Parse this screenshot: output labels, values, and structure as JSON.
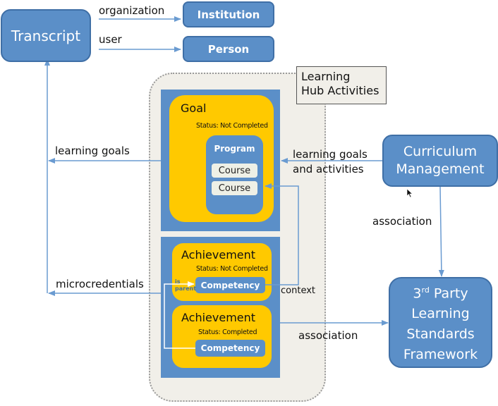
{
  "nodes": {
    "transcript": "Transcript",
    "institution": "Institution",
    "person": "Person",
    "curriculum_line1": "Curriculum",
    "curriculum_line2": "Management",
    "framework_line1_prefix": "3",
    "framework_line1_sup": "rd",
    "framework_line1_suffix": " Party",
    "framework_line2": "Learning",
    "framework_line3": "Standards",
    "framework_line4": "Framework"
  },
  "hub": {
    "title_line1": "Learning",
    "title_line2": "Hub Activities",
    "goal": {
      "title": "Goal",
      "status": "Status: Not Completed",
      "program": {
        "title": "Program",
        "courses": [
          "Course",
          "Course"
        ]
      }
    },
    "achievements": [
      {
        "title": "Achievement",
        "status": "Status: Not Completed",
        "competency": "Competency"
      },
      {
        "title": "Achievement",
        "status": "Status: Completed",
        "competency": "Competency"
      }
    ],
    "is_parent_line1": "is",
    "is_parent_line2": "parent"
  },
  "edges": {
    "organization": "organization",
    "user": "user",
    "learning_goals": "learning goals",
    "microcredentials": "microcredentials",
    "learning_goals_activities_line1": "learning goals",
    "learning_goals_activities_line2": "and activities",
    "context": "context",
    "association_vertical": "association",
    "association_horizontal": "association"
  },
  "colors": {
    "box_blue": "#5b8fc8",
    "box_border": "#3f6fa6",
    "yellow": "#ffc900",
    "arrow": "#6a9bd1",
    "hub_bg": "#f1efe9"
  }
}
